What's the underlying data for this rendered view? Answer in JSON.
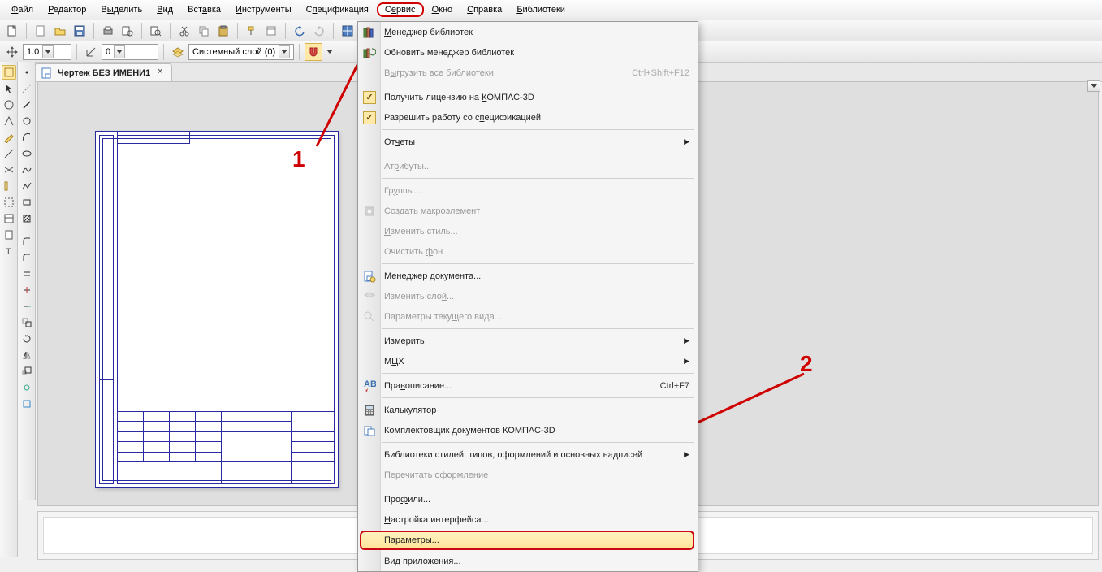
{
  "menubar": [
    {
      "label": "Файл",
      "u": "Ф"
    },
    {
      "label": "Редактор",
      "u": "Р"
    },
    {
      "label": "Выделить",
      "u": "ы"
    },
    {
      "label": "Вид",
      "u": "В"
    },
    {
      "label": "Вставка",
      "u": "а"
    },
    {
      "label": "Инструменты",
      "u": "И"
    },
    {
      "label": "Спецификация",
      "u": "п"
    },
    {
      "label": "Сервис",
      "u": "е",
      "active": true
    },
    {
      "label": "Окно",
      "u": "О"
    },
    {
      "label": "Справка",
      "u": "С"
    },
    {
      "label": "Библиотеки",
      "u": "Б"
    }
  ],
  "toolbar1_icons": [
    "file-page",
    "new-doc",
    "open",
    "save",
    "sep",
    "print",
    "preview",
    "sep",
    "inspect",
    "sep",
    "cut",
    "copy",
    "paste",
    "sep",
    "brush",
    "undo",
    "redo",
    "redo-arrow",
    "sep",
    "blue-grid",
    "green-doc",
    "fx",
    "stop",
    "sep",
    "vars"
  ],
  "toolbar2": {
    "step_value": "1.0",
    "coord_value": "0",
    "layer_label": "Системный слой (0)",
    "icons_left": [
      "move-xy"
    ],
    "icons_mid": [
      "cursor-xy"
    ],
    "icons_right": [
      "layers",
      "dropdown",
      "sep",
      "magnet",
      "arrow-down"
    ]
  },
  "tab": {
    "title": "Чертеж БЕЗ ИМЕНИ1"
  },
  "left_palette_1": [
    "mode-a",
    "mode-b",
    "geom",
    "meas",
    "dim",
    "pencil",
    "line-a",
    "line-b",
    "hatch",
    "spline",
    "rect",
    "rect2",
    "text"
  ],
  "left_palette_2": [
    "point",
    "segment",
    "circle",
    "arc",
    "ellipse",
    "spline2",
    "polyline",
    "rect3",
    "fillet",
    "chamfer",
    "offset",
    "trim",
    "extend",
    "copy2",
    "rotate",
    "mirror",
    "scale",
    "tool-a",
    "tool-b",
    "tool-c",
    "tool-d"
  ],
  "dropdown": {
    "groups": [
      [
        {
          "label": "Менеджер библиотек",
          "u": "М",
          "icon": "books"
        },
        {
          "label": "Обновить менеджер библиотек",
          "icon": "refresh-books"
        },
        {
          "label": "Выгрузить все библиотеки",
          "u": "ы",
          "disabled": true,
          "shortcut": "Ctrl+Shift+F12"
        }
      ],
      [
        {
          "label": "Получить лицензию на КОМПАС-3D",
          "u": "К",
          "check": true
        },
        {
          "label": "Разрешить работу со спецификацией",
          "u": "п",
          "check": true
        }
      ],
      [
        {
          "label": "Отчеты",
          "u": "ч",
          "submenu": true
        }
      ],
      [
        {
          "label": "Атрибуты...",
          "u": "р",
          "disabled": true
        }
      ],
      [
        {
          "label": "Группы...",
          "u": "у",
          "disabled": true
        },
        {
          "label": "Создать макроэлемент",
          "u": "э",
          "disabled": true,
          "icon": "macro"
        },
        {
          "label": "Изменить стиль...",
          "u": "И",
          "disabled": true
        },
        {
          "label": "Очистить фон",
          "u": "ф",
          "disabled": true
        }
      ],
      [
        {
          "label": "Менеджер документа...",
          "icon": "doc-mgr"
        },
        {
          "label": "Изменить слой...",
          "u": "й",
          "disabled": true,
          "icon": "layer-edit"
        },
        {
          "label": "Параметры текущего вида...",
          "u": "щ",
          "disabled": true,
          "icon": "view-params"
        }
      ],
      [
        {
          "label": "Измерить",
          "u": "з",
          "submenu": true
        },
        {
          "label": "МЦХ",
          "u": "Ц",
          "submenu": true
        }
      ],
      [
        {
          "label": "Правописание...",
          "u": "в",
          "icon": "abc",
          "shortcut": "Ctrl+F7"
        }
      ],
      [
        {
          "label": "Калькулятор",
          "u": "л",
          "icon": "calc"
        },
        {
          "label": "Комплектовщик документов КОМПАС-3D",
          "icon": "kit"
        }
      ],
      [
        {
          "label": "Библиотеки стилей, типов, оформлений и основных надписей",
          "submenu": true
        },
        {
          "label": "Перечитать оформление",
          "disabled": true
        }
      ],
      [
        {
          "label": "Профили...",
          "u": "ф"
        },
        {
          "label": "Настройка интерфейса...",
          "u": "Н"
        },
        {
          "label": "Параметры...",
          "u": "а",
          "highlight": true
        },
        {
          "label": "Вид приложения...",
          "u": "ж"
        }
      ]
    ]
  },
  "annotations": {
    "one": "1",
    "two": "2"
  }
}
